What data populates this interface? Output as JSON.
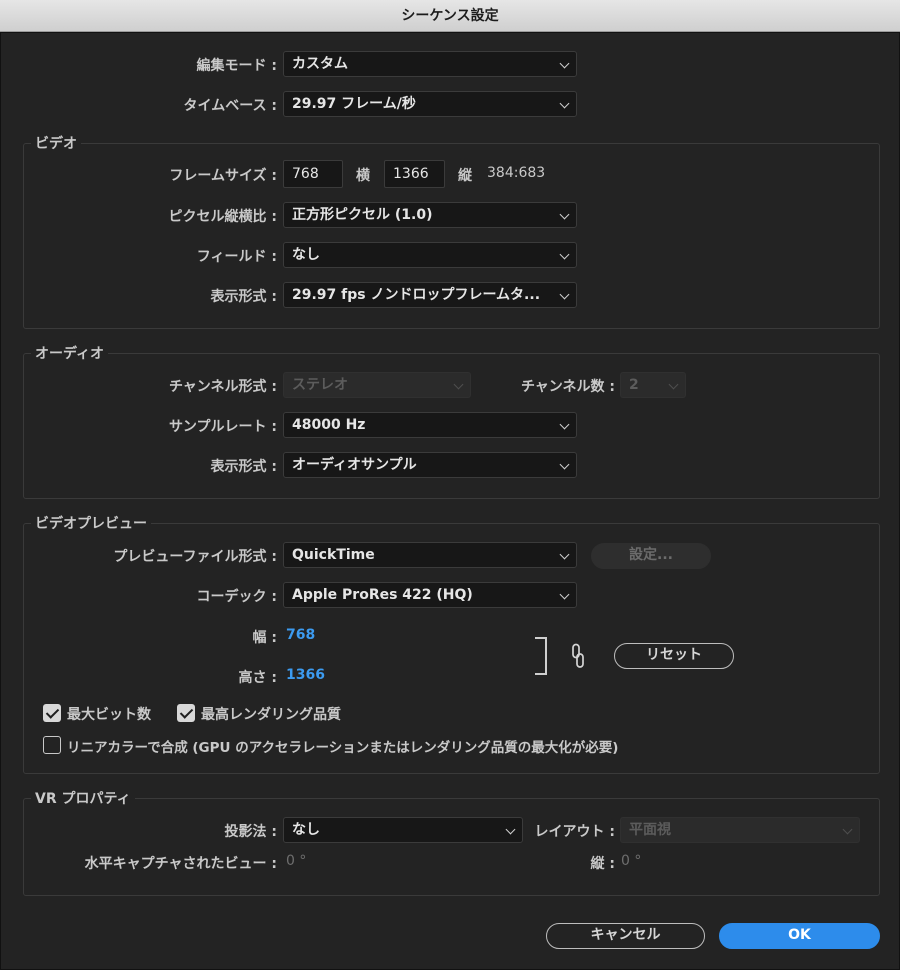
{
  "window": {
    "title": "シーケンス設定"
  },
  "edit_mode": {
    "label": "編集モード :",
    "value": "カスタム"
  },
  "timebase": {
    "label": "タイムベース :",
    "value": "29.97  フレーム/秒"
  },
  "video": {
    "title": "ビデオ",
    "frame_size_label": "フレームサイズ :",
    "width": "768",
    "width_unit": "横",
    "height": "1366",
    "height_unit": "縦",
    "aspect": "384:683",
    "pixel_aspect_label": "ピクセル縦横比 :",
    "pixel_aspect_value": "正方形ピクセル (1.0)",
    "fields_label": "フィールド :",
    "fields_value": "なし",
    "display_format_label": "表示形式 :",
    "display_format_value": "29.97 fps ノンドロップフレームタ..."
  },
  "audio": {
    "title": "オーディオ",
    "channel_format_label": "チャンネル形式 :",
    "channel_format_value": "ステレオ",
    "channel_count_label": "チャンネル数 :",
    "channel_count_value": "2",
    "sample_rate_label": "サンプルレート :",
    "sample_rate_value": "48000 Hz",
    "display_format_label": "表示形式 :",
    "display_format_value": "オーディオサンプル"
  },
  "video_preview": {
    "title": "ビデオプレビュー",
    "file_format_label": "プレビューファイル形式 :",
    "file_format_value": "QuickTime",
    "settings_button": "設定...",
    "codec_label": "コーデック :",
    "codec_value": "Apple ProRes 422 (HQ)",
    "width_label": "幅 :",
    "width_value": "768",
    "height_label": "高さ :",
    "height_value": "1366",
    "reset_button": "リセット",
    "max_bit_depth_label": "最大ビット数",
    "max_render_quality_label": "最高レンダリング品質",
    "linear_color_label": "リニアカラーで合成 (GPU のアクセラレーションまたはレンダリング品質の最大化が必要)",
    "max_bit_depth_checked": true,
    "max_render_quality_checked": true,
    "linear_color_checked": false
  },
  "vr": {
    "title": "VR プロパティ",
    "projection_label": "投影法 :",
    "projection_value": "なし",
    "layout_label": "レイアウト :",
    "layout_value": "平面視",
    "h_view_label": "水平キャプチャされたビュー :",
    "h_view_value": "0 °",
    "v_label": "縦 :",
    "v_value": "0 °"
  },
  "footer": {
    "cancel": "キャンセル",
    "ok": "OK"
  }
}
